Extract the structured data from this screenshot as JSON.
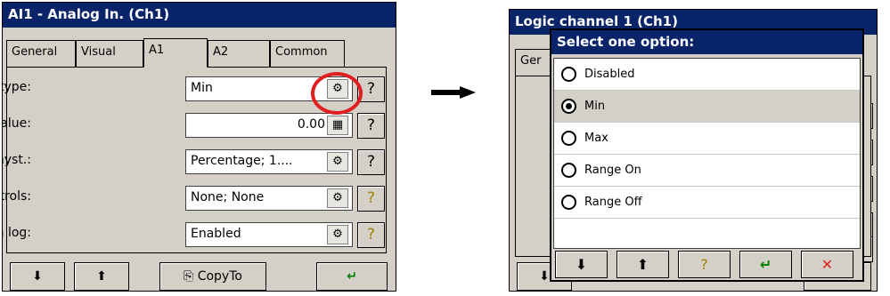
{
  "left_window": {
    "title": "AI1 - Analog In. (Ch1)",
    "tabs": [
      "General",
      "Visual",
      "A1",
      "A2",
      "Common"
    ],
    "active_tab": "A1",
    "fields": [
      {
        "label": "Alarm type:",
        "value": "Min",
        "button_icon": "settings-icon",
        "help_icon": "help-icon"
      },
      {
        "label": "Alarm value:",
        "value": "0.00",
        "button_icon": "calculator-icon",
        "help_icon": "help-icon"
      },
      {
        "label": "Alarm hyst.:",
        "value": "Percentage; 1....",
        "button_icon": "settings-icon",
        "help_icon": "help-icon"
      },
      {
        "label": "Alarm controls:",
        "value": "None; None",
        "button_icon": "settings-icon",
        "help_icon": "help-icon"
      },
      {
        "label": "Alarm log:",
        "value": "Enabled",
        "button_icon": "settings-icon",
        "help_icon": "help-icon"
      }
    ],
    "bottom_buttons": {
      "copy_to": "CopyTo"
    }
  },
  "right_window": {
    "title": "Logic channel 1 (Ch1)",
    "tab_fragment": "Ger",
    "dialog": {
      "title": "Select one option:",
      "options": [
        "Disabled",
        "Min",
        "Max",
        "Range On",
        "Range Off"
      ],
      "selected": "Min",
      "buttons": [
        "down-arrow-icon",
        "up-arrow-icon",
        "help-icon",
        "enter-icon",
        "close-icon"
      ]
    }
  },
  "colors": {
    "titlebar": "#0a246a",
    "panel": "#d4d0c8",
    "highlight_circle": "#e02020",
    "close_button": "#e02020",
    "enter_button": "#008000"
  }
}
